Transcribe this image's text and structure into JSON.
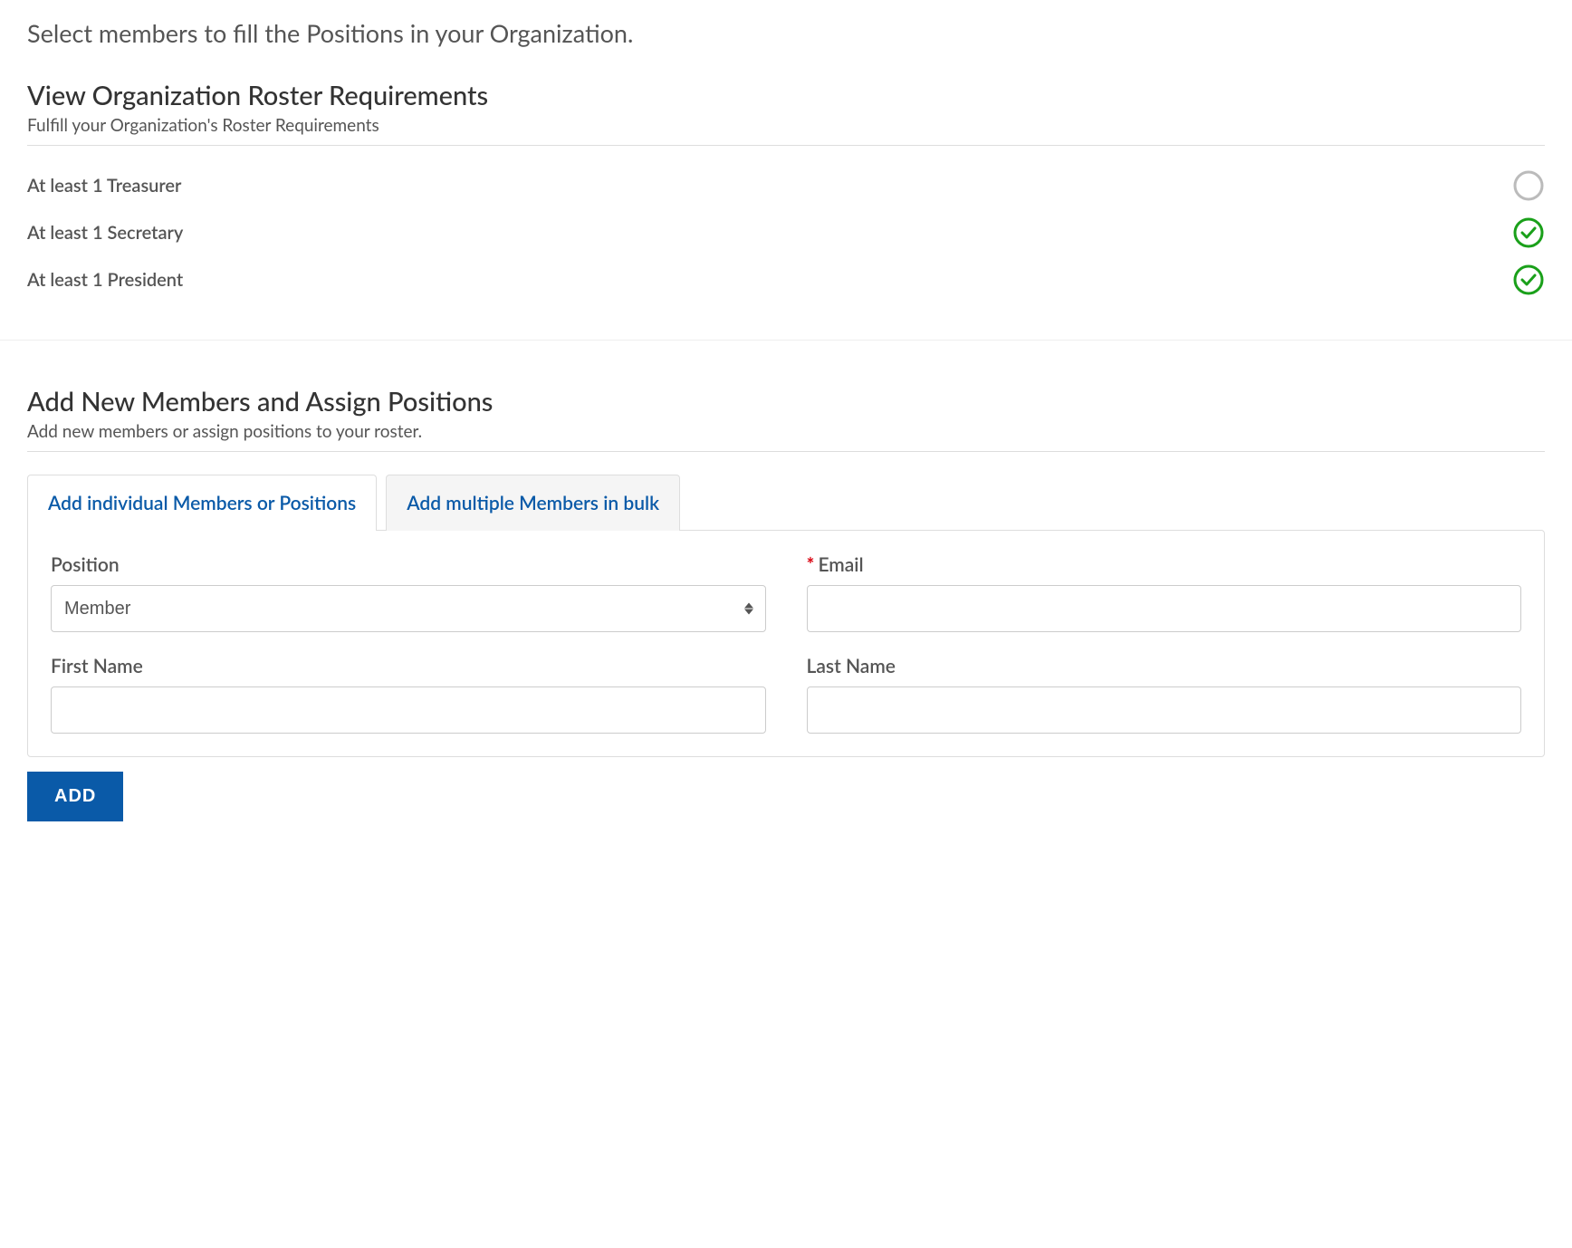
{
  "page": {
    "subtitle": "Select members to fill the Positions in your Organization."
  },
  "roster_requirements": {
    "title": "View Organization Roster Requirements",
    "subtitle": "Fulfill your Organization's Roster Requirements",
    "items": [
      {
        "label": "At least 1 Treasurer",
        "status": "incomplete"
      },
      {
        "label": "At least 1 Secretary",
        "status": "complete"
      },
      {
        "label": "At least 1 President",
        "status": "complete"
      }
    ]
  },
  "add_members": {
    "title": "Add New Members and Assign Positions",
    "subtitle": "Add new members or assign positions to your roster.",
    "tabs": {
      "individual": "Add individual Members or Positions",
      "bulk": "Add multiple Members in bulk"
    },
    "form": {
      "position_label": "Position",
      "position_selected": "Member",
      "email_label": "Email",
      "first_name_label": "First Name",
      "last_name_label": "Last Name",
      "required_mark": "*",
      "add_button": "ADD"
    }
  }
}
